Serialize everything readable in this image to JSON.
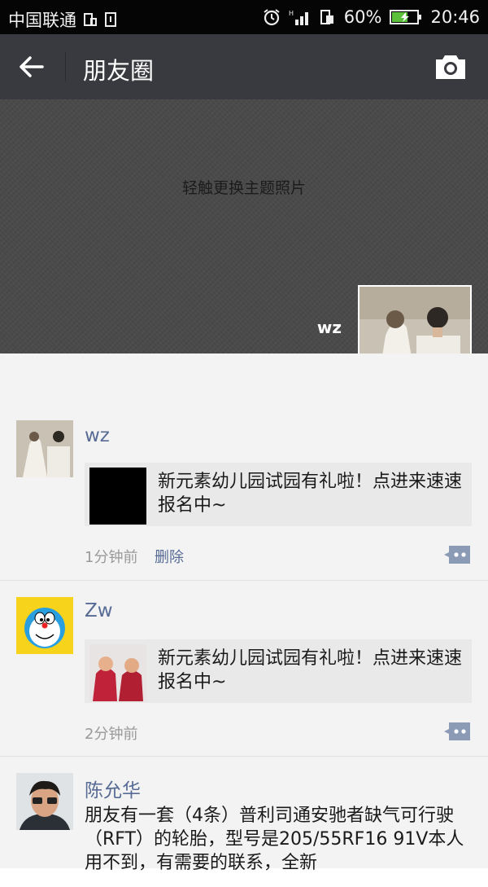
{
  "status_bar": {
    "carrier": "中国联通",
    "battery_percent": "60%",
    "time": "20:46"
  },
  "nav": {
    "title": "朋友圈"
  },
  "cover": {
    "hint": "轻触更换主题照片",
    "user_name": "wz"
  },
  "posts": [
    {
      "author": "wz",
      "link_text": "新元素幼儿园试园有礼啦！点进来速速报名中~",
      "time": "1分钟前",
      "delete_label": "删除"
    },
    {
      "author": "Zw",
      "link_text": "新元素幼儿园试园有礼啦！点进来速速报名中~",
      "time": "2分钟前"
    },
    {
      "author": "陈允华",
      "text": "朋友有一套（4条）普利司通安驰者缺气可行驶（RFT）的轮胎，型号是205/55RF16 91V本人用不到，有需要的联系，全新"
    }
  ],
  "colors": {
    "nav_bg": "#393a3f",
    "link_blue": "#576b95",
    "feed_bg": "#f3f3f3"
  }
}
